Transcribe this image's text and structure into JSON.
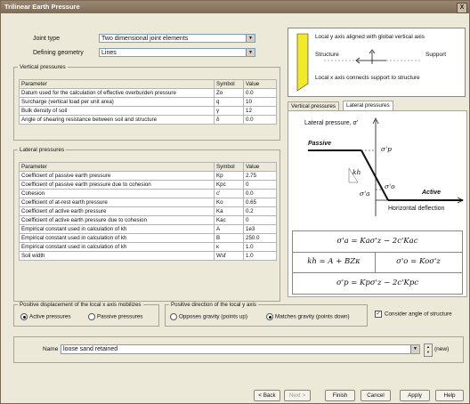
{
  "window": {
    "title": "Trilinear Earth Pressure",
    "close_label": "X"
  },
  "joint": {
    "joint_type_label": "Joint type",
    "joint_type_value": "Two dimensional joint elements",
    "defining_geometry_label": "Defining geometry",
    "defining_geometry_value": "Lines"
  },
  "vertical": {
    "legend": "Vertical pressures",
    "headers": [
      "Parameter",
      "Symbol",
      "Value"
    ],
    "rows": [
      [
        "Datum used for the calculation of effective overburden pressure",
        "Zo",
        "0.0"
      ],
      [
        "Surcharge (vertical load per unit area)",
        "q",
        "10"
      ],
      [
        "Bulk density of soil",
        "γ",
        "12"
      ],
      [
        "Angle of shearing resistance between soil and structure",
        "δ",
        "0.0"
      ]
    ]
  },
  "lateral": {
    "legend": "Lateral pressures",
    "headers": [
      "Parameter",
      "Symbol",
      "Value"
    ],
    "rows": [
      [
        "Coefficient of passive earth pressure",
        "Kp",
        "2.75"
      ],
      [
        "Coefficient of passive earth pressure due to cohesion",
        "Kpc",
        "0"
      ],
      [
        "Cohesion",
        "c'",
        "0.0"
      ],
      [
        "Coefficient of at-rest earth pressure",
        "Ko",
        "0.65"
      ],
      [
        "Coefficient of active earth pressure",
        "Ka",
        "0.2"
      ],
      [
        "Coefficient of active earth pressure due to cohesion",
        "Kac",
        "0"
      ],
      [
        "Empirical constant used in calculation of kh",
        "A",
        "1e3"
      ],
      [
        "Empirical constant used in calculation of kh",
        "B",
        "250.0"
      ],
      [
        "Empirical constant used in calculation of kh",
        "κ",
        "1.0"
      ],
      [
        "Soil width",
        "Wsf",
        "1.0"
      ]
    ]
  },
  "diagram": {
    "local_y_text": "Local y axis aligned with global vertical axis",
    "structure_label": "Structure",
    "support_label": "Support",
    "local_x_text": "Local x axis connects support to structure"
  },
  "tabs": [
    {
      "label": "Vertical pressures",
      "active": false
    },
    {
      "label": "Lateral pressures",
      "active": true
    }
  ],
  "graph": {
    "y_axis_label": "Lateral pressure, σ'",
    "x_axis_label": "Horizontal deflection",
    "passive_label": "Passive",
    "active_label": "Active",
    "sigma_p_label": "σ'p",
    "sigma_o_label": "σ'o",
    "sigma_a_label": "σ'a",
    "kh_label": "kh"
  },
  "formulas": {
    "f1": "σ'a = Kaσ'z − 2c'Kac",
    "f2": "kh = A + BZκ",
    "f3": "σ'o = Koσ'z",
    "f4": "σ'p = Kpσ'z − 2c'Kpc"
  },
  "displacement": {
    "label": "Positive displacement of the local x axis mobilizes",
    "active_option": "Active pressures",
    "passive_option": "Passive pressures",
    "selected": "active"
  },
  "direction": {
    "label": "Positive direction of the local y axis",
    "opposes_option": "Opposes gravity (points up)",
    "matches_option": "Matches gravity (points down)",
    "selected": "matches"
  },
  "consider_angle": {
    "label": "Consider angle of structure",
    "checked": true
  },
  "name_row": {
    "label": "Name",
    "value": "loose sand retained",
    "new_label": "(new)"
  },
  "buttons": {
    "back": "< Back",
    "next": "Next >",
    "finish": "Finish",
    "cancel": "Cancel",
    "apply": "Apply",
    "help": "Help"
  },
  "colors": {
    "title_bar": "#8a7863",
    "dialog_bg": "#ece9d8",
    "diagram_yellow": "#f2ea28",
    "background": "#b8a58a"
  }
}
